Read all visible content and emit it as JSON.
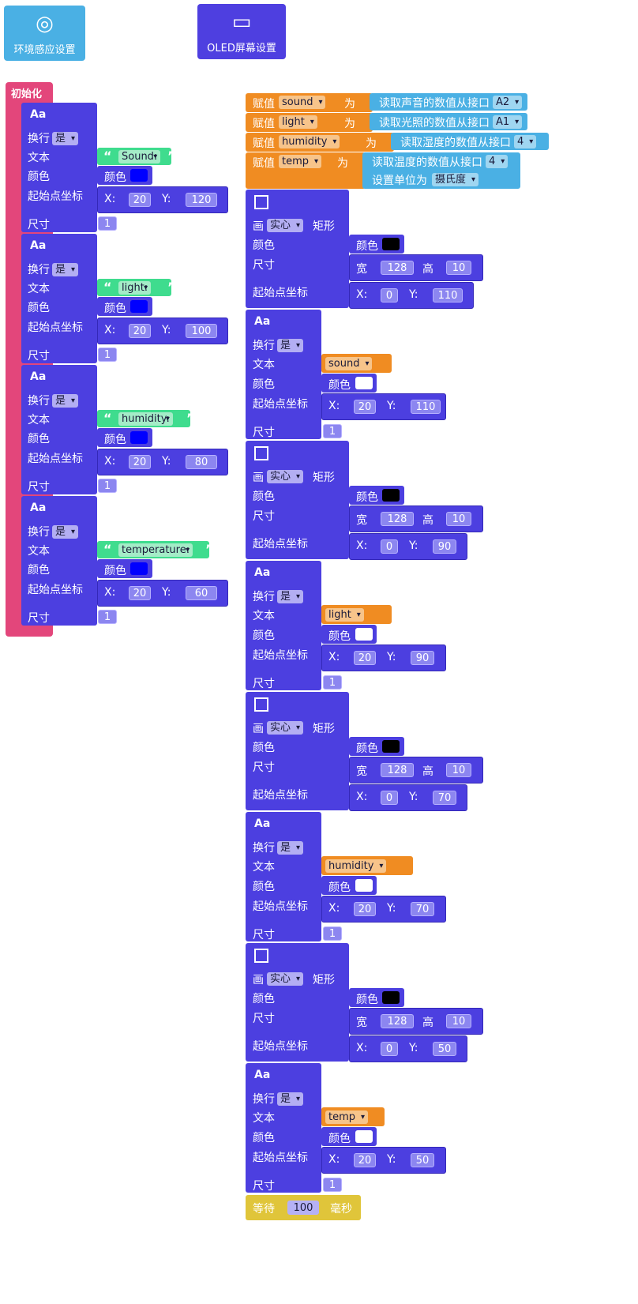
{
  "categories": {
    "env": "环境感应设置",
    "oled": "OLED屏幕设置"
  },
  "init_label": "初始化",
  "labels": {
    "aa": "Aa",
    "wrap": "换行",
    "text": "文本",
    "color": "颜色",
    "origin": "起始点坐标",
    "size": "尺寸",
    "yes": "是",
    "x": "X:",
    "y": "Y:",
    "draw": "画",
    "solid": "实心",
    "rect": "矩形",
    "width": "宽",
    "height": "高",
    "assign": "赋值",
    "as": "为",
    "set_unit": "设置单位为",
    "celsius": "摄氏度",
    "wait": "等待",
    "ms": "毫秒"
  },
  "left_blocks": [
    {
      "text": "Sound:",
      "x": "20",
      "y": "120",
      "size": "1"
    },
    {
      "text": "light:",
      "x": "20",
      "y": "100",
      "size": "1"
    },
    {
      "text": "humidity:",
      "x": "20",
      "y": "80",
      "size": "1"
    },
    {
      "text": "temperature:",
      "x": "20",
      "y": "60",
      "size": "1"
    }
  ],
  "assignments": [
    {
      "var": "sound",
      "read": "读取声音的数值从接口",
      "port": "A2"
    },
    {
      "var": "light",
      "read": "读取光照的数值从接口",
      "port": "A1"
    },
    {
      "var": "humidity",
      "read": "读取湿度的数值从接口",
      "port": "4"
    },
    {
      "var": "temp",
      "read": "读取温度的数值从接口",
      "port": "4"
    }
  ],
  "rects": [
    {
      "w": "128",
      "h": "10",
      "x": "0",
      "y": "110"
    },
    {
      "w": "128",
      "h": "10",
      "x": "0",
      "y": "90"
    },
    {
      "w": "128",
      "h": "10",
      "x": "0",
      "y": "70"
    },
    {
      "w": "128",
      "h": "10",
      "x": "0",
      "y": "50"
    }
  ],
  "texts": [
    {
      "var": "sound",
      "x": "20",
      "y": "110",
      "size": "1"
    },
    {
      "var": "light",
      "x": "20",
      "y": "90",
      "size": "1"
    },
    {
      "var": "humidity",
      "x": "20",
      "y": "70",
      "size": "1"
    },
    {
      "var": "temp",
      "x": "20",
      "y": "50",
      "size": "1"
    }
  ],
  "wait_ms": "100",
  "colors": {
    "blue_fill": "#0000ff",
    "black_fill": "#000000",
    "white_fill": "#ffffff"
  }
}
